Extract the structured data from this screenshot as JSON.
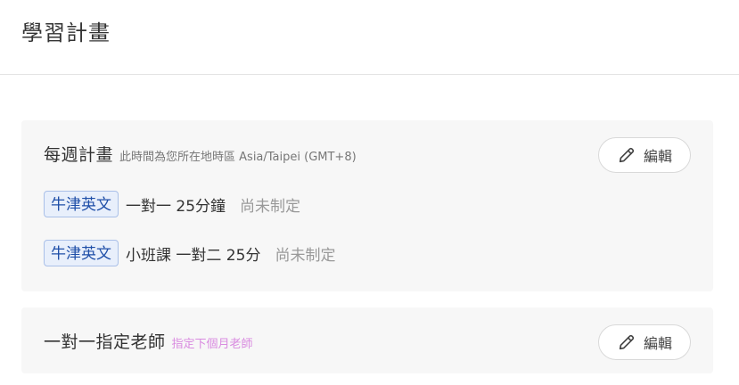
{
  "header": {
    "title": "學習計畫"
  },
  "weekly": {
    "title": "每週計畫",
    "note": "此時間為您所在地時區 Asia/Taipei (GMT+8)",
    "edit_label": "編輯",
    "plans": [
      {
        "tag": "牛津英文",
        "name": "一對一 25分鐘",
        "status": "尚未制定"
      },
      {
        "tag": "牛津英文",
        "name": "小班課 一對二 25分",
        "status": "尚未制定"
      }
    ]
  },
  "teacher": {
    "title": "一對一指定老師",
    "note": "指定下個月老師",
    "edit_label": "編輯"
  },
  "icons": {
    "edit": "pencil-icon"
  },
  "colors": {
    "card_bg": "#f7f7f7",
    "tag_bg": "#e8effb",
    "tag_text": "#1f4fa8",
    "status_text": "#999999",
    "note_pink": "#d98be0"
  }
}
